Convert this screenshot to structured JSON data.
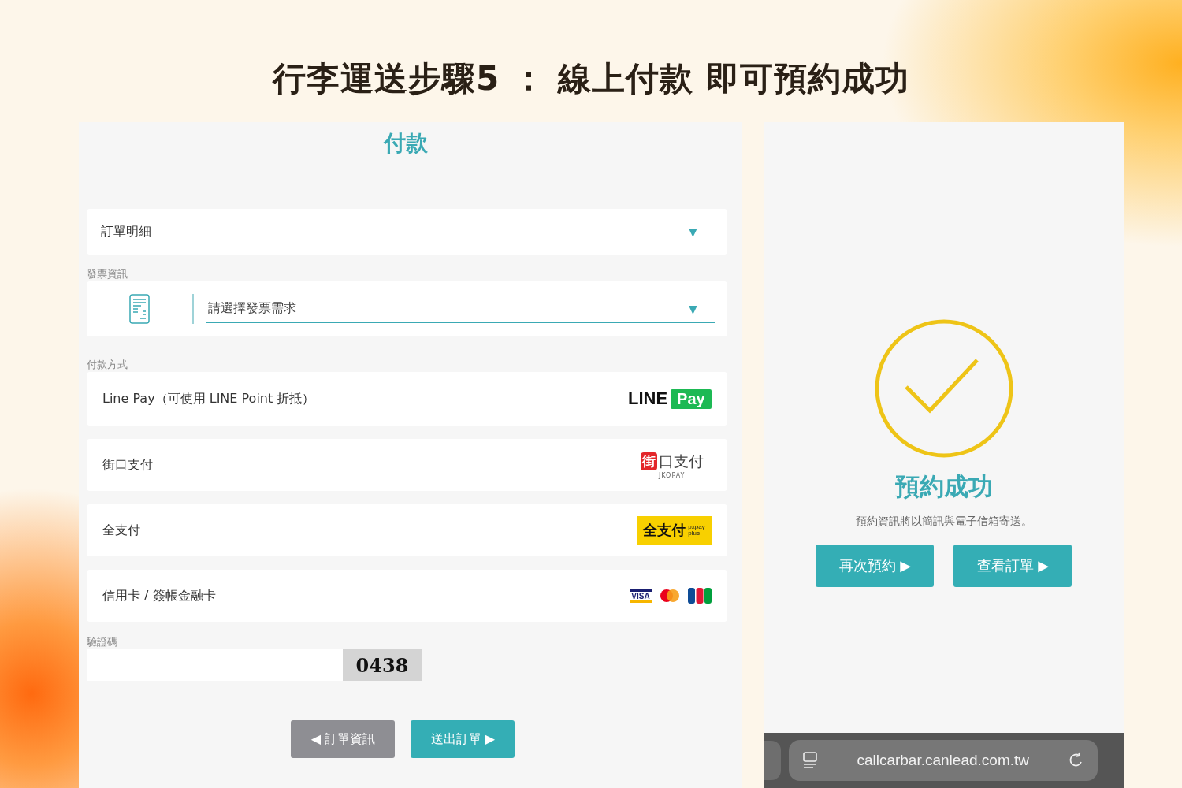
{
  "headline": "行李運送步驟5 ： 線上付款 即可預約成功",
  "payment_screen": {
    "title": "付款",
    "order_details": {
      "label": "訂單明細",
      "caret": "▼"
    },
    "invoice": {
      "section_label": "發票資訊",
      "placeholder": "請選擇發票需求",
      "caret": "▼"
    },
    "payment_section_label": "付款方式",
    "methods": [
      {
        "kind": "linepay",
        "label": "Line Pay（可使用 LINE Point 折抵）",
        "logo": [
          "LINE",
          "Pay"
        ]
      },
      {
        "kind": "jkopay",
        "label": "街口支付",
        "logo": [
          "街",
          "口支付",
          "JKOPAY"
        ]
      },
      {
        "kind": "pxpay",
        "label": "全支付",
        "logo": [
          "全支付",
          "pxpay",
          "plus"
        ]
      },
      {
        "kind": "cards",
        "label": "信用卡 / 簽帳金融卡",
        "logo": [
          "VISA"
        ]
      }
    ],
    "captcha": {
      "label": "驗證碼",
      "code": "0438"
    },
    "buttons": [
      {
        "kind": "back",
        "label": "◀ 訂單資訊"
      },
      {
        "kind": "primary",
        "label": "送出訂單 ▶"
      }
    ]
  },
  "success_screen": {
    "title": "預約成功",
    "message": "預約資訊將以簡訊與電子信箱寄送。",
    "buttons": [
      {
        "kind": "primary",
        "label": "再次預約 ▶"
      },
      {
        "kind": "primary",
        "label": "查看訂單 ▶"
      }
    ],
    "browser_bar": {
      "url": "callcarbar.canlead.com.tw"
    }
  }
}
